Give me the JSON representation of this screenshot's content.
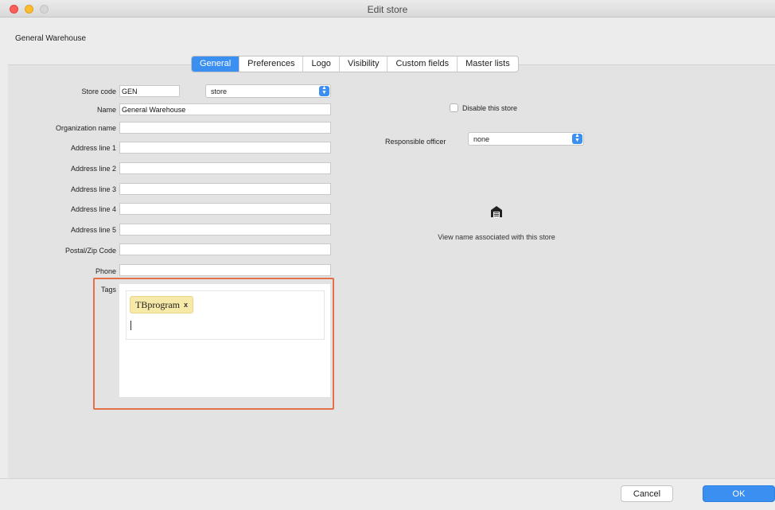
{
  "window": {
    "title": "Edit store"
  },
  "store_heading": "General Warehouse",
  "tabs": [
    {
      "label": "General",
      "active": true
    },
    {
      "label": "Preferences",
      "active": false
    },
    {
      "label": "Logo",
      "active": false
    },
    {
      "label": "Visibility",
      "active": false
    },
    {
      "label": "Custom fields",
      "active": false
    },
    {
      "label": "Master lists",
      "active": false
    }
  ],
  "form": {
    "store_code_label": "Store code",
    "store_code_value": "GEN",
    "store_type_value": "store",
    "name_label": "Name",
    "name_value": "General Warehouse",
    "org_label": "Organization name",
    "address1_label": "Address line 1",
    "address2_label": "Address line 2",
    "address3_label": "Address line 3",
    "address4_label": "Address line 4",
    "address5_label": "Address line 5",
    "postal_label": "Postal/Zip Code",
    "phone_label": "Phone",
    "tags_label": "Tags",
    "tag_chip": "TBprogram",
    "tag_remove": "x"
  },
  "right": {
    "disable_label": "Disable this store",
    "officer_label": "Responsible officer",
    "officer_value": "none",
    "view_name_caption": "View name associated with this store"
  },
  "buttons": {
    "cancel": "Cancel",
    "ok": "OK"
  },
  "colors": {
    "accent": "#3b8ff0",
    "highlight_border": "#e4704b",
    "tag_chip_bg": "#f7e9a8"
  }
}
